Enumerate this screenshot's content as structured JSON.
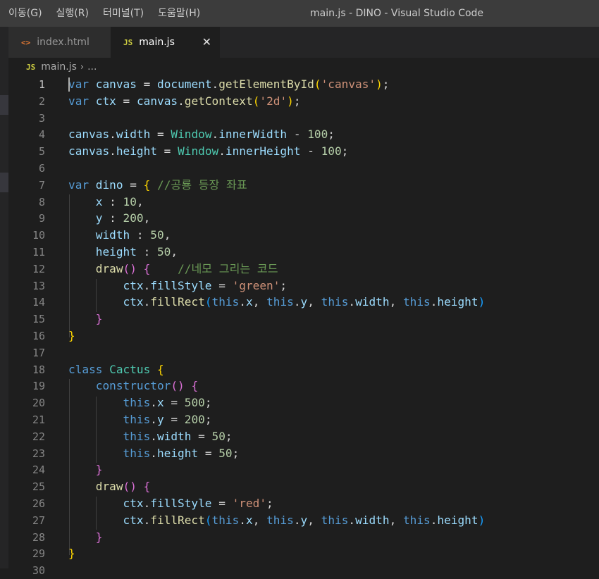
{
  "menu": [
    "이동(G)",
    "실행(R)",
    "터미널(T)",
    "도움말(H)"
  ],
  "window_title": "main.js - DINO - Visual Studio Code",
  "tabs": [
    {
      "label": "index.html",
      "icon": "<>",
      "active": false
    },
    {
      "label": "main.js",
      "icon": "JS",
      "active": true,
      "close": "✕"
    }
  ],
  "breadcrumb": {
    "icon": "JS",
    "file": "main.js",
    "separator": "›",
    "rest": "..."
  },
  "colors": {
    "keyword": "#569cd6",
    "variable": "#9cdcfe",
    "function": "#dcdcaa",
    "string": "#ce9178",
    "number": "#b5cea8",
    "comment": "#6a9955",
    "class": "#4ec9b0",
    "bracket1": "#ffd700",
    "bracket2": "#da70d6",
    "bracket3": "#179fff"
  },
  "code": [
    [
      {
        "t": "var",
        "c": "keyword"
      },
      {
        "t": " "
      },
      {
        "t": "canvas",
        "c": "variable"
      },
      {
        "t": " = "
      },
      {
        "t": "document",
        "c": "variable"
      },
      {
        "t": "."
      },
      {
        "t": "getElementById",
        "c": "function"
      },
      {
        "t": "(",
        "c": "bracket1"
      },
      {
        "t": "'canvas'",
        "c": "string"
      },
      {
        "t": ")",
        "c": "bracket1"
      },
      {
        "t": ";"
      }
    ],
    [
      {
        "t": "var",
        "c": "keyword"
      },
      {
        "t": " "
      },
      {
        "t": "ctx",
        "c": "variable"
      },
      {
        "t": " = "
      },
      {
        "t": "canvas",
        "c": "variable"
      },
      {
        "t": "."
      },
      {
        "t": "getContext",
        "c": "function"
      },
      {
        "t": "(",
        "c": "bracket1"
      },
      {
        "t": "'2d'",
        "c": "string"
      },
      {
        "t": ")",
        "c": "bracket1"
      },
      {
        "t": ";"
      }
    ],
    [],
    [
      {
        "t": "canvas",
        "c": "variable"
      },
      {
        "t": "."
      },
      {
        "t": "width",
        "c": "variable"
      },
      {
        "t": " = "
      },
      {
        "t": "Window",
        "c": "class"
      },
      {
        "t": "."
      },
      {
        "t": "innerWidth",
        "c": "variable"
      },
      {
        "t": " - "
      },
      {
        "t": "100",
        "c": "number"
      },
      {
        "t": ";"
      }
    ],
    [
      {
        "t": "canvas",
        "c": "variable"
      },
      {
        "t": "."
      },
      {
        "t": "height",
        "c": "variable"
      },
      {
        "t": " = "
      },
      {
        "t": "Window",
        "c": "class"
      },
      {
        "t": "."
      },
      {
        "t": "innerHeight",
        "c": "variable"
      },
      {
        "t": " - "
      },
      {
        "t": "100",
        "c": "number"
      },
      {
        "t": ";"
      }
    ],
    [],
    [
      {
        "t": "var",
        "c": "keyword"
      },
      {
        "t": " "
      },
      {
        "t": "dino",
        "c": "variable"
      },
      {
        "t": " = "
      },
      {
        "t": "{",
        "c": "bracket1"
      },
      {
        "t": " "
      },
      {
        "t": "//공룡 등장 좌표",
        "c": "comment"
      }
    ],
    [
      {
        "t": "    "
      },
      {
        "t": "x",
        "c": "variable"
      },
      {
        "t": " : "
      },
      {
        "t": "10",
        "c": "number"
      },
      {
        "t": ","
      }
    ],
    [
      {
        "t": "    "
      },
      {
        "t": "y",
        "c": "variable"
      },
      {
        "t": " : "
      },
      {
        "t": "200",
        "c": "number"
      },
      {
        "t": ","
      }
    ],
    [
      {
        "t": "    "
      },
      {
        "t": "width",
        "c": "variable"
      },
      {
        "t": " : "
      },
      {
        "t": "50",
        "c": "number"
      },
      {
        "t": ","
      }
    ],
    [
      {
        "t": "    "
      },
      {
        "t": "height",
        "c": "variable"
      },
      {
        "t": " : "
      },
      {
        "t": "50",
        "c": "number"
      },
      {
        "t": ","
      }
    ],
    [
      {
        "t": "    "
      },
      {
        "t": "draw",
        "c": "function"
      },
      {
        "t": "()",
        "c": "bracket2"
      },
      {
        "t": " "
      },
      {
        "t": "{",
        "c": "bracket2"
      },
      {
        "t": "    "
      },
      {
        "t": "//네모 그리는 코드",
        "c": "comment"
      }
    ],
    [
      {
        "t": "        "
      },
      {
        "t": "ctx",
        "c": "variable"
      },
      {
        "t": "."
      },
      {
        "t": "fillStyle",
        "c": "variable"
      },
      {
        "t": " = "
      },
      {
        "t": "'green'",
        "c": "string"
      },
      {
        "t": ";"
      }
    ],
    [
      {
        "t": "        "
      },
      {
        "t": "ctx",
        "c": "variable"
      },
      {
        "t": "."
      },
      {
        "t": "fillRect",
        "c": "function"
      },
      {
        "t": "(",
        "c": "bracket3"
      },
      {
        "t": "this",
        "c": "keyword"
      },
      {
        "t": "."
      },
      {
        "t": "x",
        "c": "variable"
      },
      {
        "t": ", "
      },
      {
        "t": "this",
        "c": "keyword"
      },
      {
        "t": "."
      },
      {
        "t": "y",
        "c": "variable"
      },
      {
        "t": ", "
      },
      {
        "t": "this",
        "c": "keyword"
      },
      {
        "t": "."
      },
      {
        "t": "width",
        "c": "variable"
      },
      {
        "t": ", "
      },
      {
        "t": "this",
        "c": "keyword"
      },
      {
        "t": "."
      },
      {
        "t": "height",
        "c": "variable"
      },
      {
        "t": ")",
        "c": "bracket3"
      }
    ],
    [
      {
        "t": "    "
      },
      {
        "t": "}",
        "c": "bracket2"
      }
    ],
    [
      {
        "t": "}",
        "c": "bracket1"
      }
    ],
    [],
    [
      {
        "t": "class",
        "c": "keyword"
      },
      {
        "t": " "
      },
      {
        "t": "Cactus",
        "c": "class"
      },
      {
        "t": " "
      },
      {
        "t": "{",
        "c": "bracket1"
      }
    ],
    [
      {
        "t": "    "
      },
      {
        "t": "constructor",
        "c": "keyword"
      },
      {
        "t": "()",
        "c": "bracket2"
      },
      {
        "t": " "
      },
      {
        "t": "{",
        "c": "bracket2"
      }
    ],
    [
      {
        "t": "        "
      },
      {
        "t": "this",
        "c": "keyword"
      },
      {
        "t": "."
      },
      {
        "t": "x",
        "c": "variable"
      },
      {
        "t": " = "
      },
      {
        "t": "500",
        "c": "number"
      },
      {
        "t": ";"
      }
    ],
    [
      {
        "t": "        "
      },
      {
        "t": "this",
        "c": "keyword"
      },
      {
        "t": "."
      },
      {
        "t": "y",
        "c": "variable"
      },
      {
        "t": " = "
      },
      {
        "t": "200",
        "c": "number"
      },
      {
        "t": ";"
      }
    ],
    [
      {
        "t": "        "
      },
      {
        "t": "this",
        "c": "keyword"
      },
      {
        "t": "."
      },
      {
        "t": "width",
        "c": "variable"
      },
      {
        "t": " = "
      },
      {
        "t": "50",
        "c": "number"
      },
      {
        "t": ";"
      }
    ],
    [
      {
        "t": "        "
      },
      {
        "t": "this",
        "c": "keyword"
      },
      {
        "t": "."
      },
      {
        "t": "height",
        "c": "variable"
      },
      {
        "t": " = "
      },
      {
        "t": "50",
        "c": "number"
      },
      {
        "t": ";"
      }
    ],
    [
      {
        "t": "    "
      },
      {
        "t": "}",
        "c": "bracket2"
      }
    ],
    [
      {
        "t": "    "
      },
      {
        "t": "draw",
        "c": "function"
      },
      {
        "t": "()",
        "c": "bracket2"
      },
      {
        "t": " "
      },
      {
        "t": "{",
        "c": "bracket2"
      }
    ],
    [
      {
        "t": "        "
      },
      {
        "t": "ctx",
        "c": "variable"
      },
      {
        "t": "."
      },
      {
        "t": "fillStyle",
        "c": "variable"
      },
      {
        "t": " = "
      },
      {
        "t": "'red'",
        "c": "string"
      },
      {
        "t": ";"
      }
    ],
    [
      {
        "t": "        "
      },
      {
        "t": "ctx",
        "c": "variable"
      },
      {
        "t": "."
      },
      {
        "t": "fillRect",
        "c": "function"
      },
      {
        "t": "(",
        "c": "bracket3"
      },
      {
        "t": "this",
        "c": "keyword"
      },
      {
        "t": "."
      },
      {
        "t": "x",
        "c": "variable"
      },
      {
        "t": ", "
      },
      {
        "t": "this",
        "c": "keyword"
      },
      {
        "t": "."
      },
      {
        "t": "y",
        "c": "variable"
      },
      {
        "t": ", "
      },
      {
        "t": "this",
        "c": "keyword"
      },
      {
        "t": "."
      },
      {
        "t": "width",
        "c": "variable"
      },
      {
        "t": ", "
      },
      {
        "t": "this",
        "c": "keyword"
      },
      {
        "t": "."
      },
      {
        "t": "height",
        "c": "variable"
      },
      {
        "t": ")",
        "c": "bracket3"
      }
    ],
    [
      {
        "t": "    "
      },
      {
        "t": "}",
        "c": "bracket2"
      }
    ],
    [
      {
        "t": "}",
        "c": "bracket1"
      }
    ],
    []
  ]
}
